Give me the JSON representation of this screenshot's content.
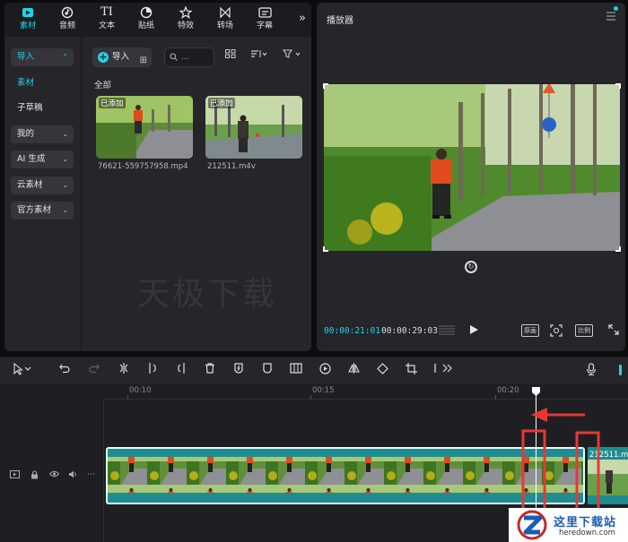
{
  "top_tabs": [
    {
      "label": "素材",
      "icon": "media-icon",
      "active": true
    },
    {
      "label": "音频",
      "icon": "audio-icon",
      "active": false
    },
    {
      "label": "文本",
      "icon": "text-icon",
      "active": false
    },
    {
      "label": "贴纸",
      "icon": "sticker-icon",
      "active": false
    },
    {
      "label": "特效",
      "icon": "effects-icon",
      "active": false
    },
    {
      "label": "转场",
      "icon": "transition-icon",
      "active": false
    },
    {
      "label": "字幕",
      "icon": "caption-icon",
      "active": false
    }
  ],
  "tab_glyphs": {
    "text": "TI"
  },
  "more_tabs_glyph": "»",
  "sidebar": {
    "items": [
      {
        "label": "导入",
        "chevron": "⌃",
        "selected": true,
        "pill": true
      },
      {
        "label": "素材",
        "chevron": "",
        "selected": true,
        "pill": false
      },
      {
        "label": "子草稿",
        "chevron": "",
        "selected": false,
        "pill": false
      },
      {
        "label": "我的",
        "chevron": "⌄",
        "selected": false,
        "pill": true
      },
      {
        "label": "AI 生成",
        "chevron": "⌄",
        "selected": false,
        "pill": true
      },
      {
        "label": "云素材",
        "chevron": "⌄",
        "selected": false,
        "pill": true
      },
      {
        "label": "官方素材",
        "chevron": "⌄",
        "selected": false,
        "pill": true
      }
    ]
  },
  "media": {
    "import_label": "导入",
    "search_placeholder": "...",
    "section_label": "全部",
    "items": [
      {
        "badge": "已添加",
        "filename": "76621-559757958.mp4"
      },
      {
        "badge": "已添加",
        "filename": "212511.m4v"
      }
    ],
    "watermark": "天极下载"
  },
  "player": {
    "title": "播放器",
    "current_time": "00:00:21:01",
    "total_time": "00:00:29:03",
    "original_label": "原画",
    "ratio_label": "比例"
  },
  "timeline": {
    "ruler_labels": [
      "00:10",
      "00:15",
      "00:20"
    ],
    "clip2_name": "212511.m"
  },
  "logo": {
    "title": "这里下载站",
    "subtitle": "heredown.com"
  },
  "colors": {
    "accent": "#22d3e6",
    "clip": "#1f8d8f",
    "annotation": "#e53935"
  }
}
